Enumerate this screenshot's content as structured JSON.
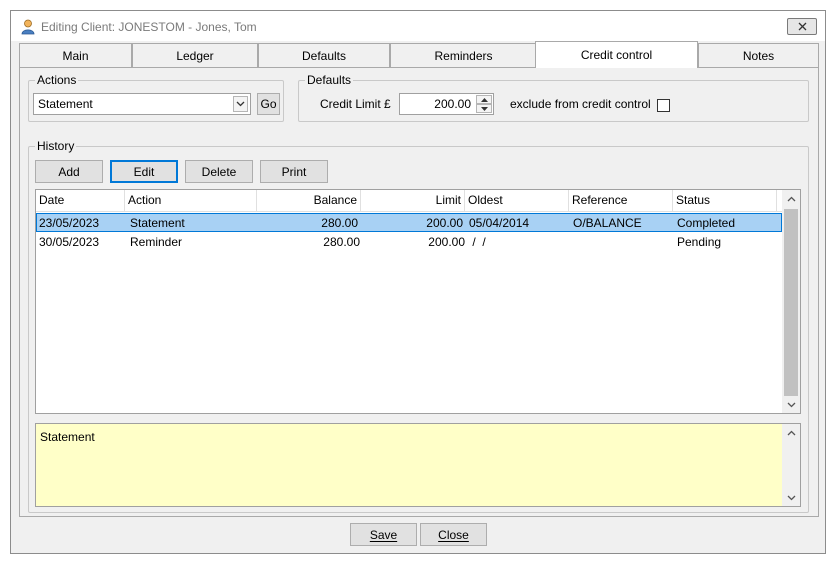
{
  "window": {
    "title": "Editing Client: JONESTOM - Jones, Tom"
  },
  "tabs": [
    {
      "label": "Main"
    },
    {
      "label": "Ledger"
    },
    {
      "label": "Defaults"
    },
    {
      "label": "Reminders"
    },
    {
      "label": "Credit control"
    },
    {
      "label": "Notes"
    }
  ],
  "active_tab": "Credit control",
  "actions_group": {
    "legend": "Actions",
    "selected": "Statement",
    "go_label": "Go"
  },
  "defaults_group": {
    "legend": "Defaults",
    "credit_limit_label": "Credit Limit £",
    "credit_limit_value": "200.00",
    "exclude_label": "exclude from credit control",
    "exclude_checked": false
  },
  "history_group": {
    "legend": "History",
    "buttons": {
      "add": "Add",
      "edit": "Edit",
      "delete": "Delete",
      "print": "Print"
    },
    "columns": [
      "Date",
      "Action",
      "Balance",
      "Limit",
      "Oldest",
      "Reference",
      "Status"
    ],
    "rows": [
      [
        "23/05/2023",
        "Statement",
        "280.00",
        "200.00",
        "05/04/2014",
        "O/BALANCE",
        "Completed"
      ],
      [
        "30/05/2023",
        "Reminder",
        "280.00",
        "200.00",
        " /  /",
        "",
        "Pending"
      ]
    ],
    "note_text": "Statement"
  },
  "footer": {
    "save": "Save",
    "close": "Close"
  },
  "colors": {
    "selection": "#a8d1f4",
    "selection_border": "#0078d7",
    "notes_bg": "#ffffc8"
  }
}
